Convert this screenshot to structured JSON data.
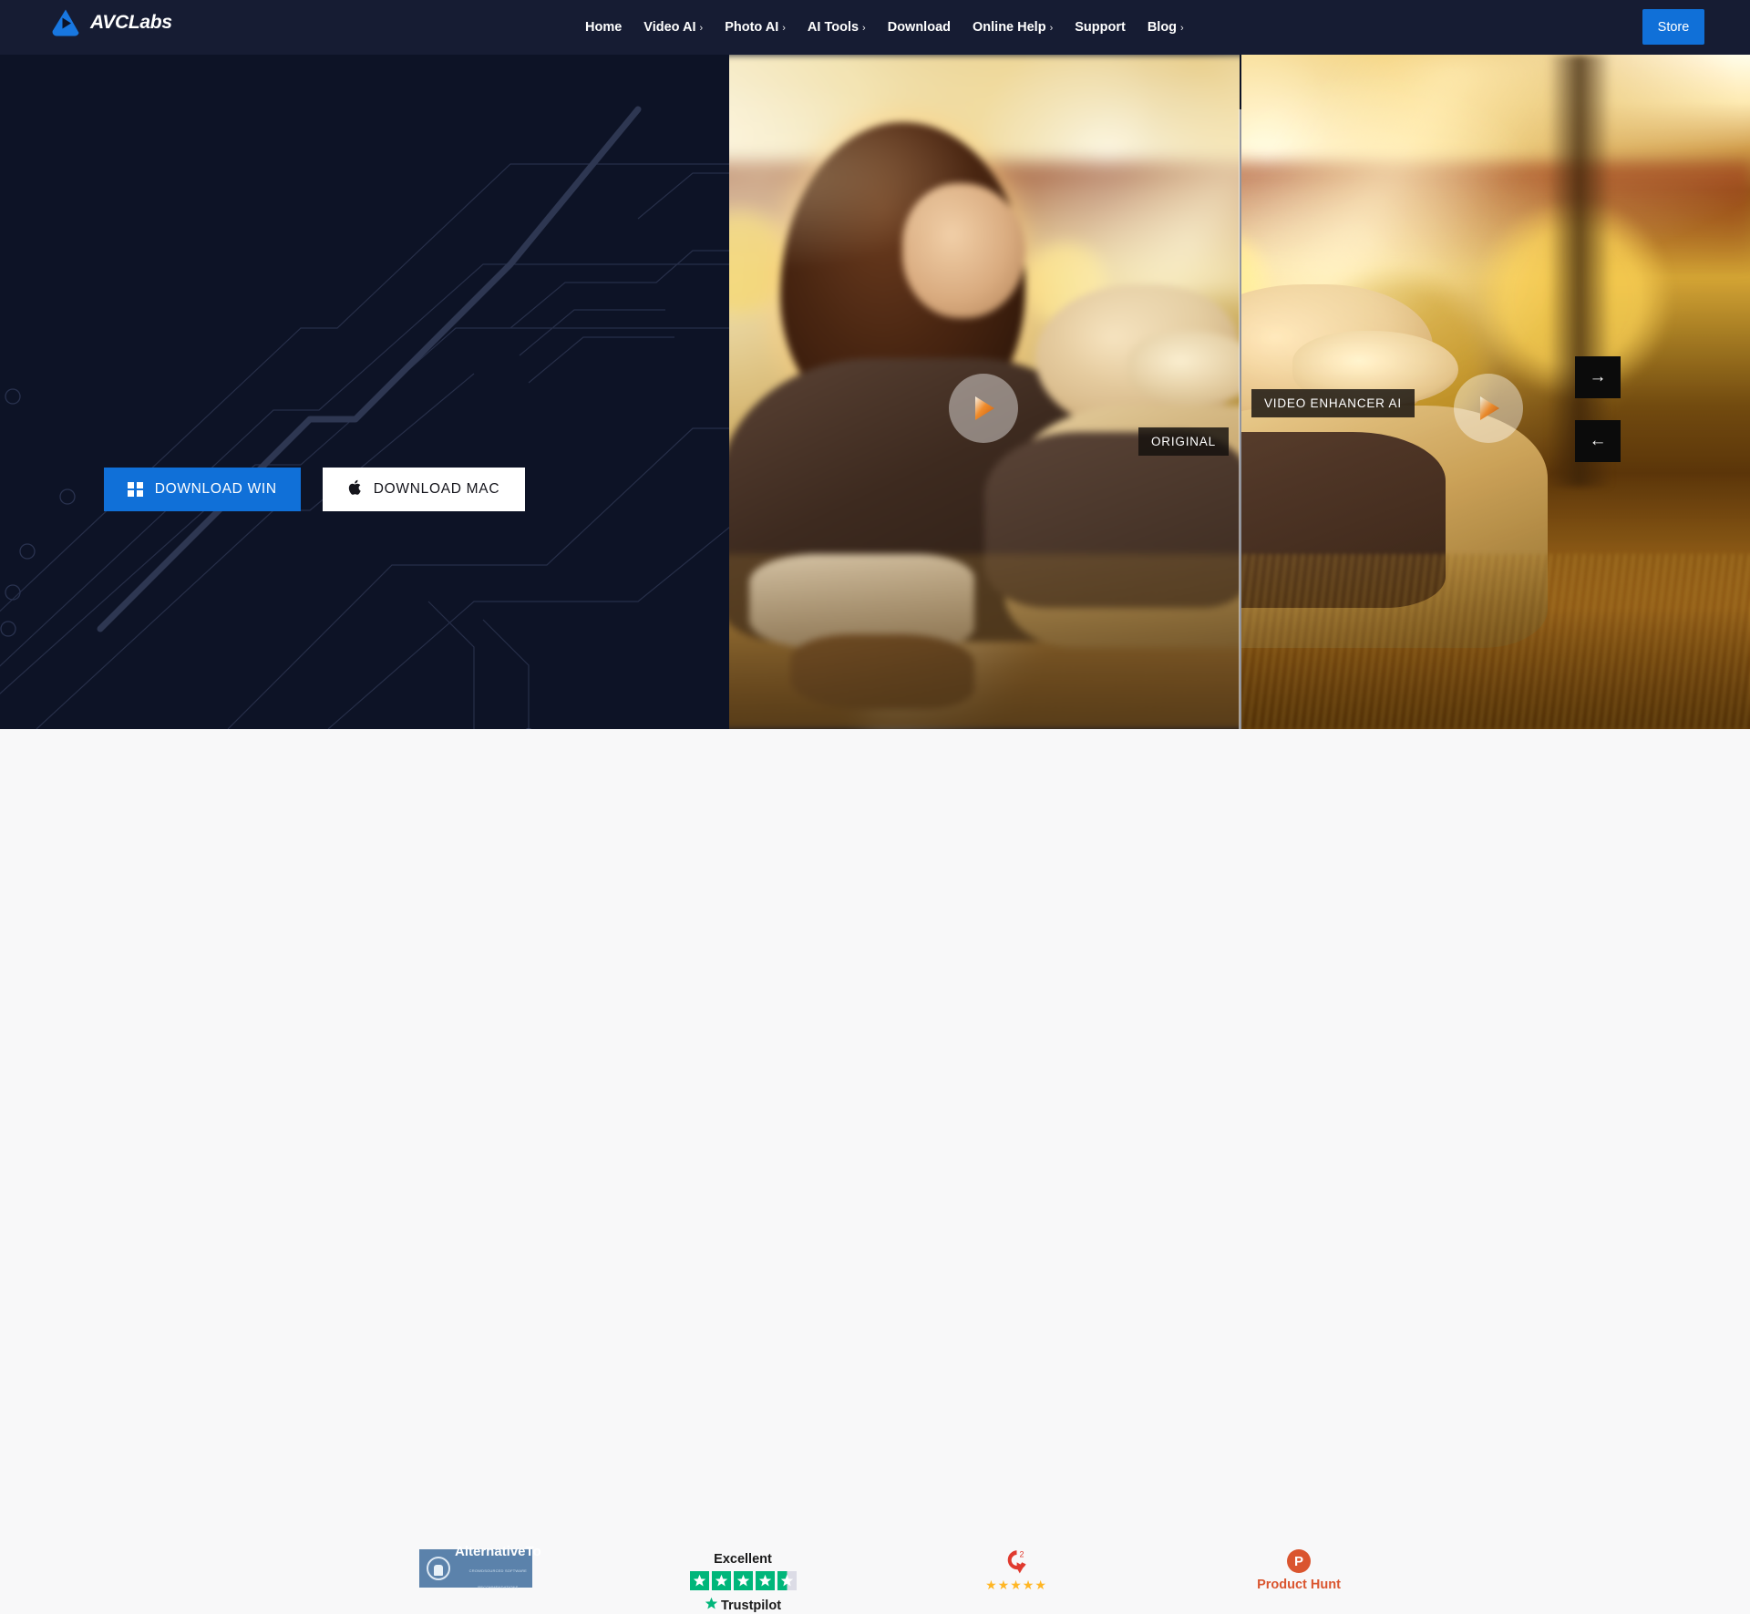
{
  "header": {
    "logo_text": "AVCLabs",
    "logo_icon": "avclabs-play-triangle-logo",
    "nav": [
      {
        "label": "Home",
        "has_submenu": false
      },
      {
        "label": "Video AI",
        "has_submenu": true
      },
      {
        "label": "Photo AI",
        "has_submenu": true
      },
      {
        "label": "AI Tools",
        "has_submenu": true
      },
      {
        "label": "Download",
        "has_submenu": false
      },
      {
        "label": "Online Help",
        "has_submenu": true
      },
      {
        "label": "Support",
        "has_submenu": false
      },
      {
        "label": "Blog",
        "has_submenu": true
      }
    ],
    "caret": "›",
    "store_label": "Store",
    "store_color": "#1070d8"
  },
  "hero": {
    "background_color": "#0d1326",
    "download_win": {
      "label": "DOWNLOAD WIN",
      "icon": "windows-icon"
    },
    "download_mac": {
      "label": "DOWNLOAD MAC",
      "icon": "apple-icon",
      "glyph": ""
    },
    "compare": {
      "left_label": "ORIGINAL",
      "right_label": "VIDEO ENHANCER AI",
      "play_icon": "play-triangle-icon"
    },
    "carousel": {
      "next_glyph": "→",
      "prev_glyph": "←",
      "next_name": "next-slide",
      "prev_name": "previous-slide"
    }
  },
  "badges": {
    "background_color": "#f8f8f9",
    "alternativeto": {
      "name": "AlternativeTo",
      "tagline": "CROWDSOURCED SOFTWARE RECOMMENDATIONS",
      "color": "#5b82ab"
    },
    "trustpilot": {
      "rating_word": "Excellent",
      "brand": "Trustpilot",
      "stars_total": 5,
      "stars_filled": 4.5,
      "color": "#00b67a"
    },
    "g2": {
      "brand": "G2",
      "stars": 5,
      "logo_color": "#e03a2f",
      "star_color": "#ffb624"
    },
    "producthunt": {
      "brand": "Product Hunt",
      "mark_letter": "P",
      "color": "#da552f"
    }
  }
}
